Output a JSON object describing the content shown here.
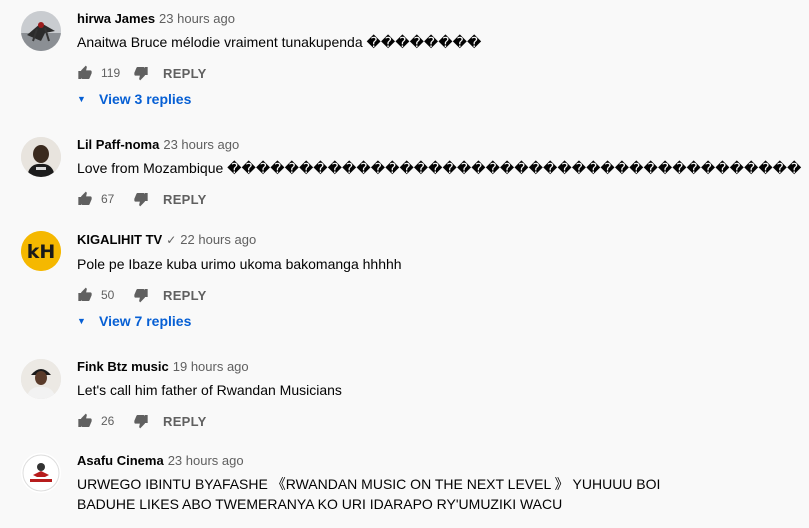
{
  "comments": [
    {
      "author": "hirwa James",
      "verified": false,
      "time": "23 hours ago",
      "text": "Anaitwa Bruce mélodie vraiment tunakupenda ��������",
      "likes": "119",
      "reply_label": "REPLY",
      "replies_label": "View 3 replies"
    },
    {
      "author": "Lil Paff-noma",
      "verified": false,
      "time": "23 hours ago",
      "text": "Love from Mozambique ����������������������������������������",
      "likes": "67",
      "reply_label": "REPLY"
    },
    {
      "author": "KIGALIHIT TV",
      "verified": true,
      "verified_mark": "✓",
      "time": "22 hours ago",
      "text": "Pole pe Ibaze kuba urimo ukoma bakomanga hhhhh",
      "likes": "50",
      "reply_label": "REPLY",
      "replies_label": "View 7 replies"
    },
    {
      "author": "Fink Btz music",
      "verified": false,
      "time": "19 hours ago",
      "text": "Let's call him father of Rwandan Musicians",
      "likes": "26",
      "reply_label": "REPLY"
    },
    {
      "author": "Asafu Cinema",
      "verified": false,
      "time": "23 hours ago",
      "text_lines": [
        "URWEGO IBINTU BYAFASHE 《RWANDAN MUSIC ON THE NEXT LEVEL 》 YUHUUU BOI",
        "BADUHE LIKES ABO TWEMERANYA KO URI IDARAPO RY'UMUZIKI WACU"
      ]
    }
  ],
  "colors": {
    "background": "#f9f9f9",
    "author": "#030303",
    "secondary": "#606060",
    "link": "#065fd4",
    "logo_yellow": "#f5b800"
  },
  "icons": {
    "like": "thumbs-up-icon",
    "dislike": "thumbs-down-icon",
    "expand": "caret-down-icon",
    "verified": "checkmark-icon"
  }
}
